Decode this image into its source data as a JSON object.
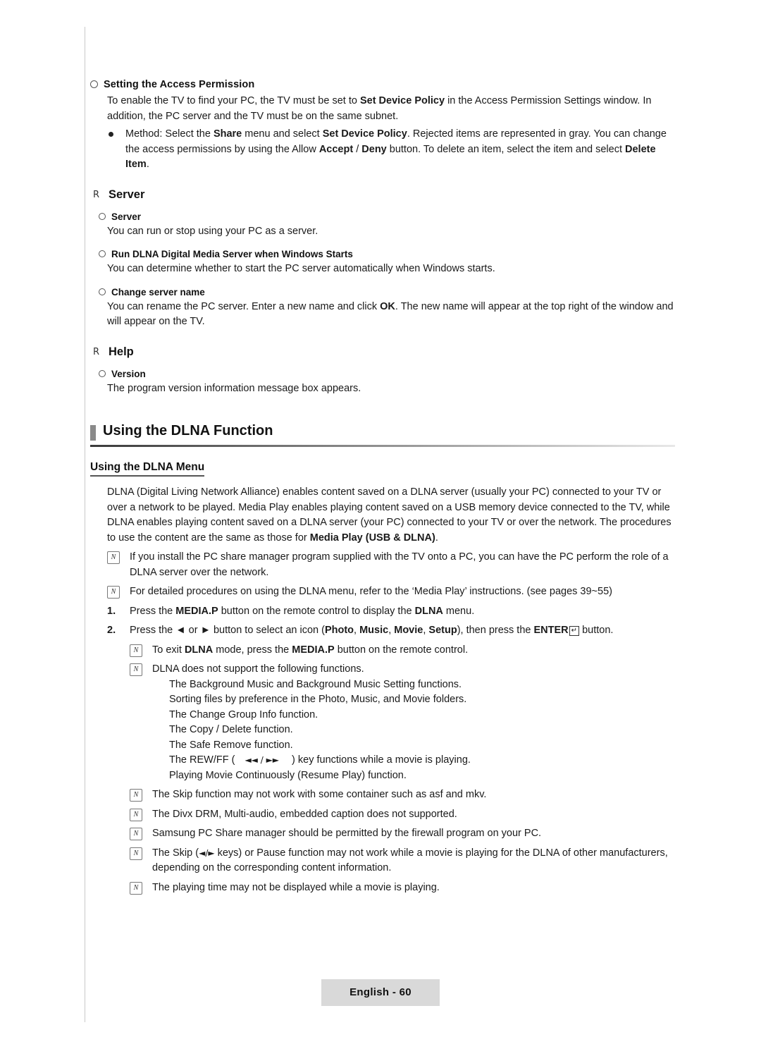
{
  "document": {
    "footer_label": "English - 60"
  },
  "access_permission": {
    "heading": "Setting the Access Permission",
    "para1_a": "To enable the TV to find your PC, the TV must be set to ",
    "para1_b": "Set Device Policy",
    "para1_c": " in the Access Permission Settings window. In addition, the PC server and the TV must be on the same subnet.",
    "method_a": "Method: Select the ",
    "method_b": "Share",
    "method_c": " menu and select ",
    "method_d": "Set Device Policy",
    "method_e": ". Rejected items are represented in gray. You can change the access permissions by using the Allow ",
    "method_f": "Accept",
    "method_g": " / ",
    "method_h": "Deny",
    "method_i": " button. To delete an item, select the item and select ",
    "method_j": "Delete Item",
    "method_k": "."
  },
  "server_section": {
    "heading": "Server",
    "items": [
      {
        "title": "Server",
        "body": "You can run or stop using your PC as a server."
      },
      {
        "title": "Run DLNA Digital Media Server when Windows Starts",
        "body": "You can determine whether to start the PC server automatically when Windows starts."
      },
      {
        "title": "Change server name",
        "body_a": "You can rename the PC server. Enter a new name and click ",
        "body_b": "OK",
        "body_c": ". The new name will appear at the top right of the window and will appear on the TV."
      }
    ]
  },
  "help_section": {
    "heading": "Help",
    "item_title": "Version",
    "item_body": "The program version information message box appears."
  },
  "dlna": {
    "title": "Using the DLNA Function",
    "menu_heading": "Using the DLNA Menu",
    "intro_a": "DLNA (Digital Living Network Alliance) enables content saved on a DLNA server (usually your PC) connected to your TV or over a network to be played. Media Play enables playing content saved on a USB memory device connected to the TV, while DLNA enables playing content saved on a DLNA server (your PC) connected to your TV or over the network. The procedures to use the content are the same as those for ",
    "intro_b": "Media Play (USB & DLNA)",
    "intro_c": ".",
    "notes_top": [
      "If you install the PC share manager program supplied with the TV onto a PC, you can have the PC perform the role of a DLNA server over the network.",
      "For detailed procedures on using the DLNA menu, refer to the ‘Media Play’ instructions. (see pages 39~55)"
    ],
    "steps": [
      {
        "num": "1.",
        "text_a": "Press the ",
        "text_b": "MEDIA.P",
        "text_c": " button on the remote control to display the ",
        "text_d": "DLNA",
        "text_e": " menu."
      },
      {
        "num": "2.",
        "text_a": "Press the ◄ or ► button to select an icon (",
        "text_b": "Photo",
        "text_c": ", ",
        "text_d": "Music",
        "text_e": ", ",
        "text_f": "Movie",
        "text_g": ", ",
        "text_h": "Setup",
        "text_i": "), then press the ",
        "text_j": "ENTER",
        "text_k": " button.",
        "enter_glyph": "↵"
      }
    ],
    "notes_exit_a": "To exit ",
    "notes_exit_b": "DLNA",
    "notes_exit_c": " mode, press the ",
    "notes_exit_d": "MEDIA.P",
    "notes_exit_e": " button on the remote control.",
    "note_unsupported": "DLNA does not support the following functions.",
    "unsupported_list": [
      "The Background Music and Background Music Setting functions.",
      "Sorting files by preference in the Photo, Music, and Movie folders.",
      "The Change Group Info function.",
      "The Copy / Delete function.",
      "The Safe Remove function."
    ],
    "rewff_a": "The REW/FF (",
    "rewff_glyph": "◄◄ / ►►",
    "rewff_b": ") key functions while a movie is playing.",
    "resume_play": "Playing Movie Continuously (Resume Play) function.",
    "notes_bottom": [
      "The Skip function may not work with some container such as asf and mkv.",
      "The Divx DRM, Multi-audio, embedded caption does not supported.",
      "Samsung PC Share manager should be permitted by the firewall program on your PC.",
      "The playing time may not be displayed while a movie is playing."
    ],
    "skip_note_a": "The Skip (",
    "skip_note_glyph": "◄/►",
    "skip_note_b": " keys) or Pause function may not work while a movie is playing for the DLNA of other manufacturers, depending on the corresponding content information."
  }
}
